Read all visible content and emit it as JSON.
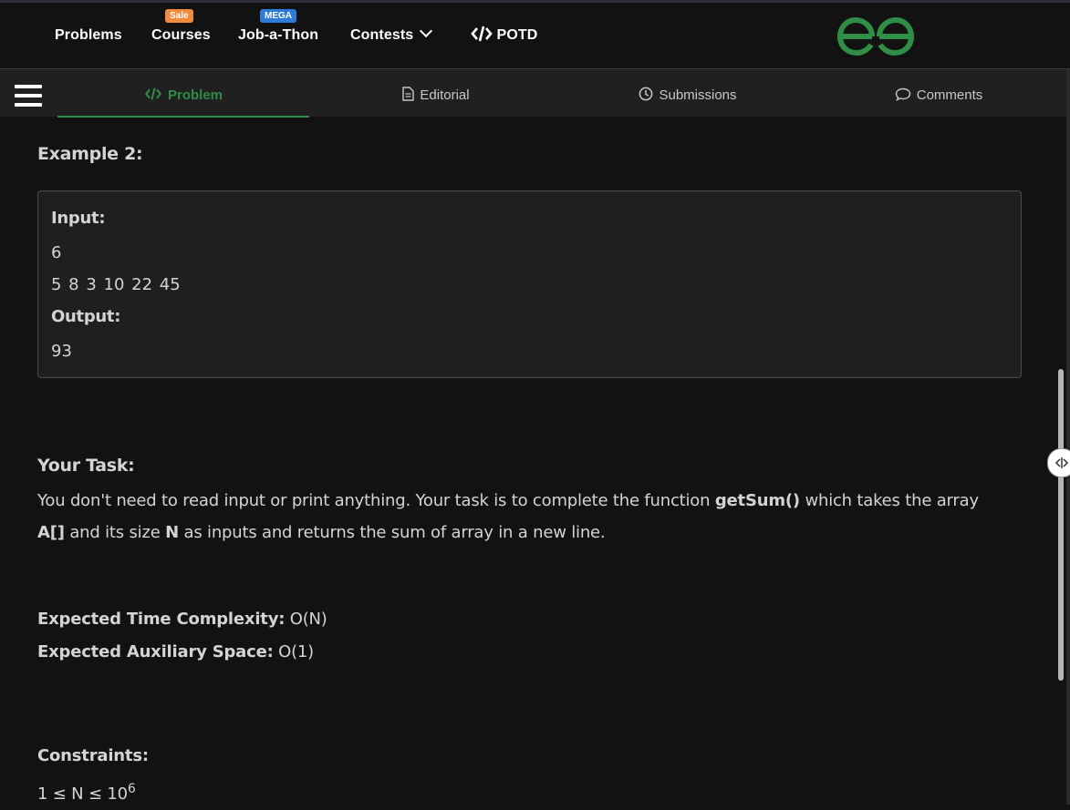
{
  "nav": {
    "problems": "Problems",
    "courses": "Courses",
    "courses_badge": "Sale",
    "jobathon": "Job-a-Thon",
    "jobathon_badge": "MEGA",
    "contests": "Contests",
    "potd": "POTD",
    "logo_icon": "gfg-logo-icon"
  },
  "tabs": {
    "problem": "Problem",
    "editorial": "Editorial",
    "submissions": "Submissions",
    "comments": "Comments"
  },
  "example": {
    "title": "Example 2:",
    "input_label": "Input:",
    "input_n": "6",
    "input_array": "5 8 3 10 22 45",
    "output_label": "Output:",
    "output_value": "93"
  },
  "task": {
    "title": "Your Task:",
    "line1_a": "You don't need to read input or print anything. Your task is to complete the function ",
    "line1_fn": "getSum()",
    "line1_b": " which takes the array",
    "line2_arr": "A[]",
    "line2_a": " and its size ",
    "line2_n": "N",
    "line2_b": " as inputs and returns the sum of array in a new line."
  },
  "complexity": {
    "time_label": "Expected Time Complexity:",
    "time_value": " O(N)",
    "space_label": "Expected Auxiliary Space:",
    "space_value": " O(1)"
  },
  "constraints": {
    "title": "Constraints:",
    "text": "1 ≤ N ≤ 10",
    "exp": "6"
  },
  "colors": {
    "accent": "#2f8d46",
    "sale_badge": "#f08a3c",
    "mega_badge": "#2c7bd6"
  }
}
